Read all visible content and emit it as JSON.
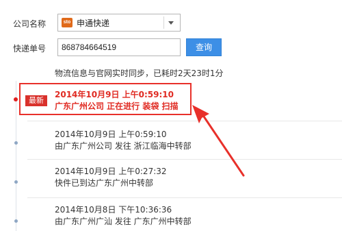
{
  "form": {
    "company_label": "公司名称",
    "company_value": "申通快递",
    "company_logo_text": "sto",
    "tracking_label": "快递单号",
    "tracking_value": "868784664519",
    "query_button": "查询"
  },
  "sync_note": "物流信息与官网实时同步，已耗时2天23时1分",
  "latest_badge": "最新",
  "entries": [
    {
      "time": "2014年10月9日 上午0:59:10",
      "status": "广东广州公司 正在进行 装袋 扫描"
    },
    {
      "time": "2014年10月9日 上午0:59:10",
      "status": "由广东广州公司 发往 浙江临海中转部"
    },
    {
      "time": "2014年10月9日 上午0:27:32",
      "status": "快件已到达广东广州中转部"
    },
    {
      "time": "2014年10月8日 下午10:36:36",
      "status": "由广东广州广汕 发往 广东广州中转部"
    }
  ],
  "colors": {
    "highlight_red": "#e8302a",
    "button_blue": "#3d8fe6"
  },
  "icons": {
    "company_logo": "sto-logo-icon",
    "dropdown": "chevron-down-icon"
  }
}
